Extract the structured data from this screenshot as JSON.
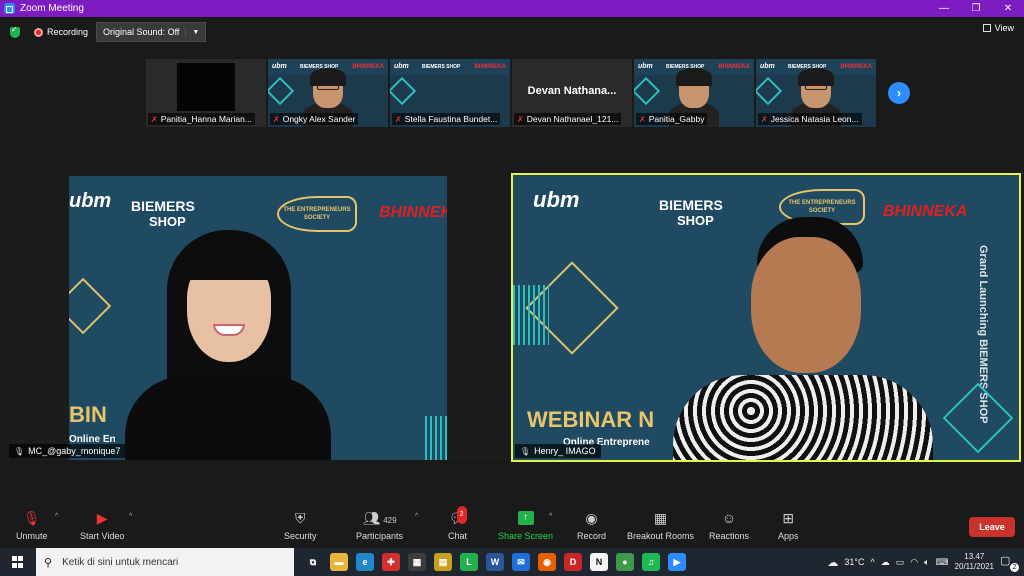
{
  "window": {
    "title": "Zoom Meeting",
    "controls": [
      "—",
      "❐",
      "✕"
    ]
  },
  "top_bar": {
    "recording_label": "Recording",
    "original_sound_label": "Original Sound: Off",
    "view_label": "View"
  },
  "gallery_strip": [
    {
      "name": "Panitia_Hanna Marian...",
      "muted": true,
      "type": "black"
    },
    {
      "name": "Ongky Alex Sander",
      "muted": true,
      "type": "video"
    },
    {
      "name": "Stella Faustina Bundet...",
      "muted": true,
      "type": "background"
    },
    {
      "name": "Devan Nathanael_121...",
      "muted": true,
      "type": "name",
      "display_name": "Devan  Nathana..."
    },
    {
      "name": "Panitia_Gabby",
      "muted": true,
      "type": "video-dark"
    },
    {
      "name": "Jessica Natasia Leon...",
      "muted": true,
      "type": "video-dark"
    }
  ],
  "thumb_logos": {
    "ubm": "ubm",
    "biemers": "BIEMERS SHOP",
    "bhinneka": "BHINNEKA"
  },
  "speakers": {
    "left": {
      "name": "MC_@gaby_monique7",
      "logos": {
        "ubm": "ubm",
        "biemers_top": "BIEMERS",
        "biemers_bottom": "SHOP",
        "society": "THE ENTREPRENEURS SOCIETY",
        "bhinneka": "BHINNEKA"
      },
      "webinar_text": "BIN",
      "subtitle": "Online En"
    },
    "right": {
      "name": "Henry_ IMAGO",
      "logos": {
        "ubm": "ubm",
        "biemers_top": "BIEMERS",
        "biemers_bottom": "SHOP",
        "society": "THE ENTREPRENEURS SOCIETY",
        "bhinneka": "BHINNEKA"
      },
      "webinar_text": "WEBINAR N",
      "subtitle": "Online Entreprene",
      "vertical_text": "Grand Launching BIEMERS SHOP"
    }
  },
  "toolbar": {
    "unmute": "Unmute",
    "start_video": "Start Video",
    "security": "Security",
    "participants": "Participants",
    "participants_count": "429",
    "chat": "Chat",
    "chat_badge": "2",
    "share_screen": "Share Screen",
    "record": "Record",
    "breakout_rooms": "Breakout Rooms",
    "reactions": "Reactions",
    "apps": "Apps",
    "leave": "Leave"
  },
  "taskbar": {
    "search_placeholder": "Ketik di sini untuk mencari",
    "temperature": "31°C",
    "time": "13.47",
    "date": "20/11/2021",
    "notifications": "2",
    "apps": [
      {
        "name": "task-view",
        "glyph": "⧉",
        "color": "#1f2630"
      },
      {
        "name": "file-explorer",
        "glyph": "▬",
        "color": "#e8b53b"
      },
      {
        "name": "edge",
        "glyph": "e",
        "color": "#1e88c8"
      },
      {
        "name": "gift",
        "glyph": "✚",
        "color": "#d32f2f"
      },
      {
        "name": "store",
        "glyph": "▦",
        "color": "#3c3c3c"
      },
      {
        "name": "notes",
        "glyph": "▤",
        "color": "#c8a020"
      },
      {
        "name": "line",
        "glyph": "L",
        "color": "#22b14c"
      },
      {
        "name": "word",
        "glyph": "W",
        "color": "#2b579a"
      },
      {
        "name": "mail",
        "glyph": "✉",
        "color": "#1f6fd6"
      },
      {
        "name": "firefox",
        "glyph": "◉",
        "color": "#e66000"
      },
      {
        "name": "dev-cpp",
        "glyph": "D",
        "color": "#c62828"
      },
      {
        "name": "notion",
        "glyph": "N",
        "color": "#f5f5f5"
      },
      {
        "name": "chrome",
        "glyph": "●",
        "color": "#3c9a4a"
      },
      {
        "name": "spotify",
        "glyph": "♫",
        "color": "#1db954"
      },
      {
        "name": "zoom",
        "glyph": "▶",
        "color": "#2d8cff"
      }
    ]
  }
}
